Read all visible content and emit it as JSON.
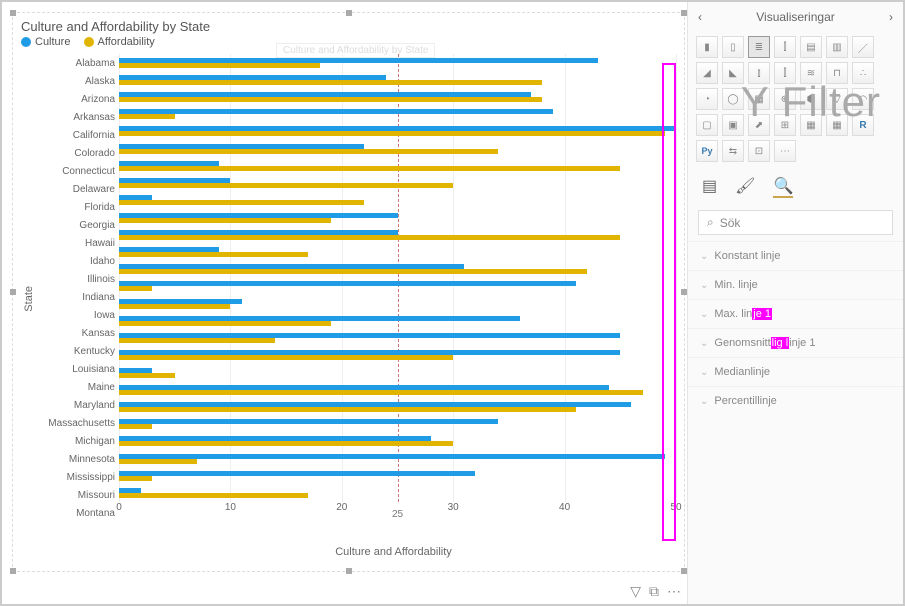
{
  "chart_data": {
    "type": "bar",
    "title": "Culture and Affordability by State",
    "xlabel": "Culture and Affordability",
    "ylabel": "State",
    "xlim": [
      0,
      50
    ],
    "xticks": [
      0,
      10,
      20,
      30,
      40,
      50
    ],
    "reference_line": 25,
    "categories": [
      "Alabama",
      "Alaska",
      "Arizona",
      "Arkansas",
      "California",
      "Colorado",
      "Connecticut",
      "Delaware",
      "Florida",
      "Georgia",
      "Hawaii",
      "Idaho",
      "Illinois",
      "Indiana",
      "Iowa",
      "Kansas",
      "Kentucky",
      "Louisiana",
      "Maine",
      "Maryland",
      "Massachusetts",
      "Michigan",
      "Minnesota",
      "Mississippi",
      "Missouri",
      "Montana"
    ],
    "series": [
      {
        "name": "Culture",
        "color": "#1f9ce5",
        "values": [
          43,
          24,
          37,
          39,
          50,
          22,
          9,
          10,
          3,
          25,
          25,
          9,
          31,
          41,
          11,
          36,
          45,
          45,
          3,
          44,
          46,
          34,
          28,
          49,
          32,
          2
        ]
      },
      {
        "name": "Affordability",
        "color": "#e1b400",
        "values": [
          18,
          38,
          38,
          5,
          49,
          34,
          45,
          30,
          22,
          19,
          45,
          17,
          42,
          3,
          10,
          19,
          14,
          30,
          5,
          47,
          41,
          3,
          30,
          7,
          3,
          17
        ]
      }
    ]
  },
  "legend": {
    "item0": "Culture",
    "item1": "Affordability"
  },
  "ghost_title": "Culture and Affordability by State",
  "side": {
    "header": "Visualiseringar",
    "search_placeholder": "Sök",
    "acc": {
      "konstant": "Konstant linje",
      "min": "Min. linje",
      "max_pre": "Max. lin",
      "max_hl": "je 1",
      "avg_pre": "Genomsnitt",
      "avg_hl": "lig l",
      "avg_post": "inje 1",
      "median": "Medianlinje",
      "percentil": "Percentillinje"
    }
  },
  "overlay_text": "Y Filter",
  "r_label": "R",
  "py_label": "Py"
}
